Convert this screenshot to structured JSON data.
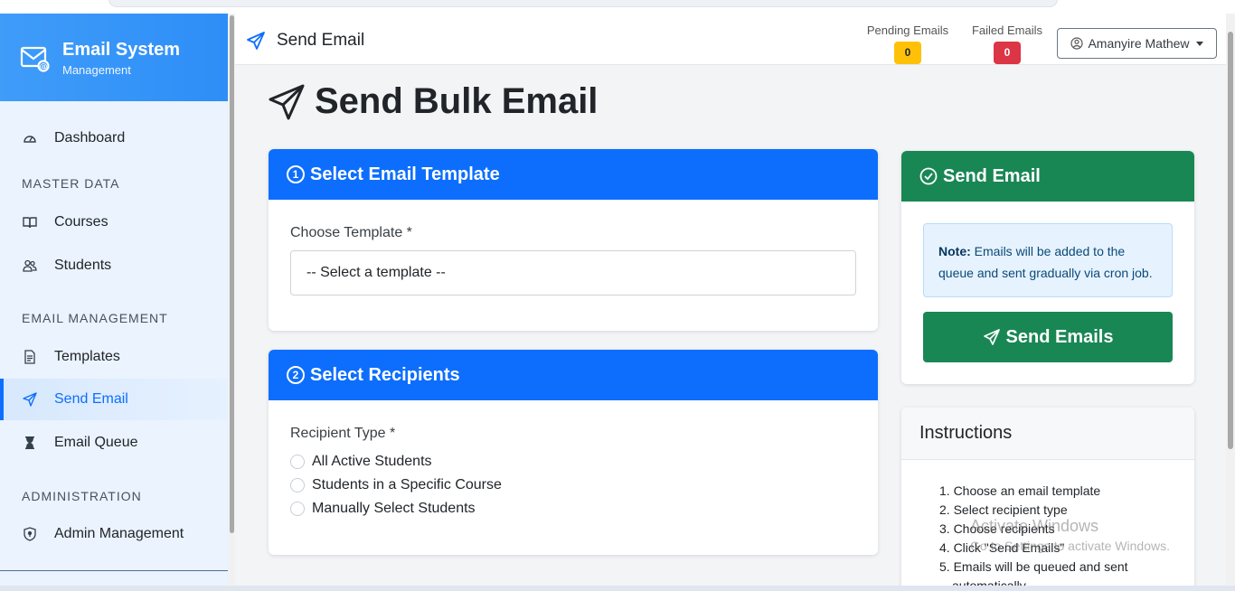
{
  "brand": {
    "title": "Email System",
    "subtitle": "Management",
    "icon": "envelope-at-icon"
  },
  "sidebar": {
    "dashboard": "Dashboard",
    "section_master": "MASTER DATA",
    "courses": "Courses",
    "students": "Students",
    "section_email": "EMAIL MANAGEMENT",
    "templates": "Templates",
    "send_email": "Send Email",
    "email_queue": "Email Queue",
    "section_admin": "ADMINISTRATION",
    "admin_management": "Admin Management",
    "active_item": "Send Email"
  },
  "topbar": {
    "title": "Send Email",
    "pending_label": "Pending Emails",
    "pending_count": "0",
    "failed_label": "Failed Emails",
    "failed_count": "0",
    "user_name": "Amanyire Mathew"
  },
  "page": {
    "heading": "Send Bulk Email"
  },
  "template_card": {
    "step": "1",
    "title": "Select Email Template",
    "label": "Choose Template *",
    "selected": "-- Select a template --"
  },
  "recipients_card": {
    "step": "2",
    "title": "Select Recipients",
    "label": "Recipient Type *",
    "options": [
      "All Active Students",
      "Students in a Specific Course",
      "Manually Select Students"
    ]
  },
  "send_card": {
    "title": "Send Email",
    "note_bold": "Note:",
    "note_text": "Emails will be added to the queue and sent gradually via cron job.",
    "button": "Send Emails"
  },
  "instructions": {
    "title": "Instructions",
    "items": [
      "1. Choose an email template",
      "2. Select recipient type",
      "3. Choose recipients",
      "4. Click \"Send Emails\"",
      "5. Emails will be queued and sent",
      "automatically"
    ]
  },
  "watermark": {
    "line1": "Activate Windows",
    "line2": "Go to Settings to activate Windows."
  },
  "colors": {
    "primary": "#0d6efd",
    "success": "#198754",
    "warning": "#ffc107",
    "danger": "#dc3545"
  }
}
